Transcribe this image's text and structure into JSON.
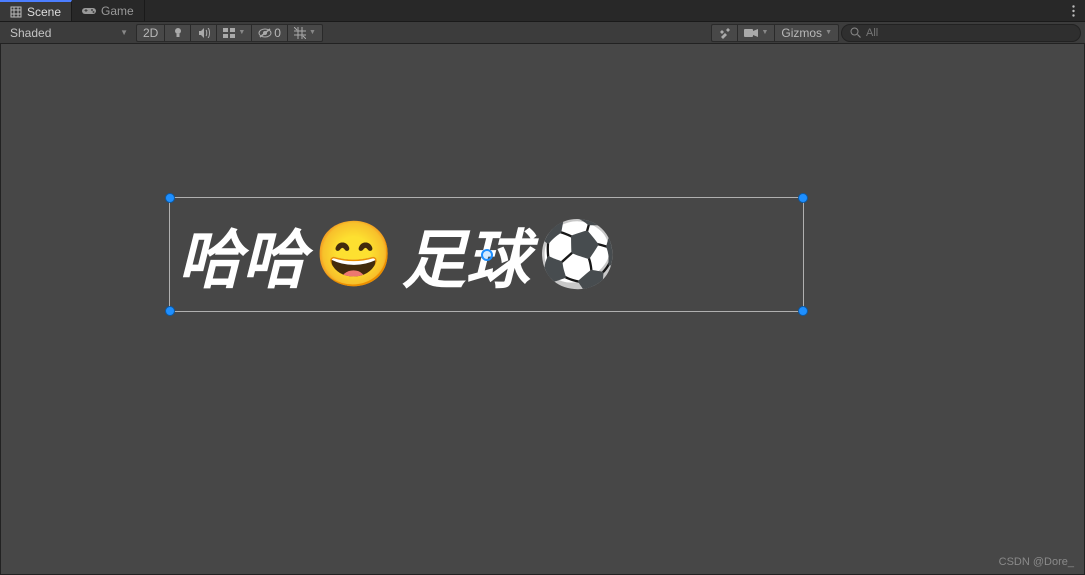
{
  "tabs": {
    "scene": "Scene",
    "game": "Game"
  },
  "toolbar": {
    "shading_mode": "Shaded",
    "view_2d": "2D",
    "hidden_count": "0",
    "gizmos_label": "Gizmos"
  },
  "search": {
    "placeholder": "All"
  },
  "scene_text": {
    "part1": "哈哈",
    "emoji1": "😄",
    "part2": "足球",
    "emoji2": "⚽"
  },
  "watermark": "CSDN @Dore_"
}
